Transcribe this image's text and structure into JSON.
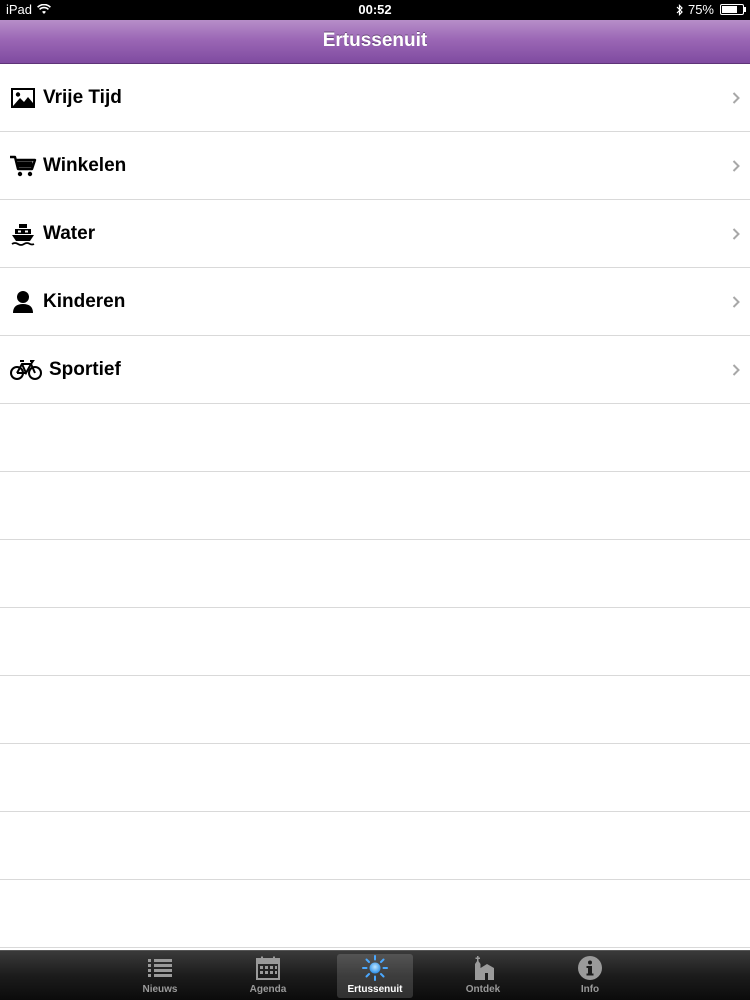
{
  "status_bar": {
    "device": "iPad",
    "time": "00:52",
    "battery": "75%",
    "battery_level": 0.75
  },
  "nav": {
    "title": "Ertussenuit"
  },
  "list": {
    "items": [
      {
        "label": "Vrije Tijd",
        "icon": "picture-icon"
      },
      {
        "label": "Winkelen",
        "icon": "shopping-cart-icon"
      },
      {
        "label": "Water",
        "icon": "ship-icon"
      },
      {
        "label": "Kinderen",
        "icon": "person-icon"
      },
      {
        "label": "Sportief",
        "icon": "bicycle-icon"
      }
    ]
  },
  "tabs": [
    {
      "label": "Nieuws",
      "icon": "list-icon"
    },
    {
      "label": "Agenda",
      "icon": "calendar-icon"
    },
    {
      "label": "Ertussenuit",
      "icon": "sun-icon",
      "active": true
    },
    {
      "label": "Ontdek",
      "icon": "church-icon"
    },
    {
      "label": "Info",
      "icon": "info-icon"
    }
  ],
  "colors": {
    "nav_top": "#b78ec9",
    "nav_bottom": "#7f4ba0",
    "active_tab_icon": "#3aa0ff"
  }
}
